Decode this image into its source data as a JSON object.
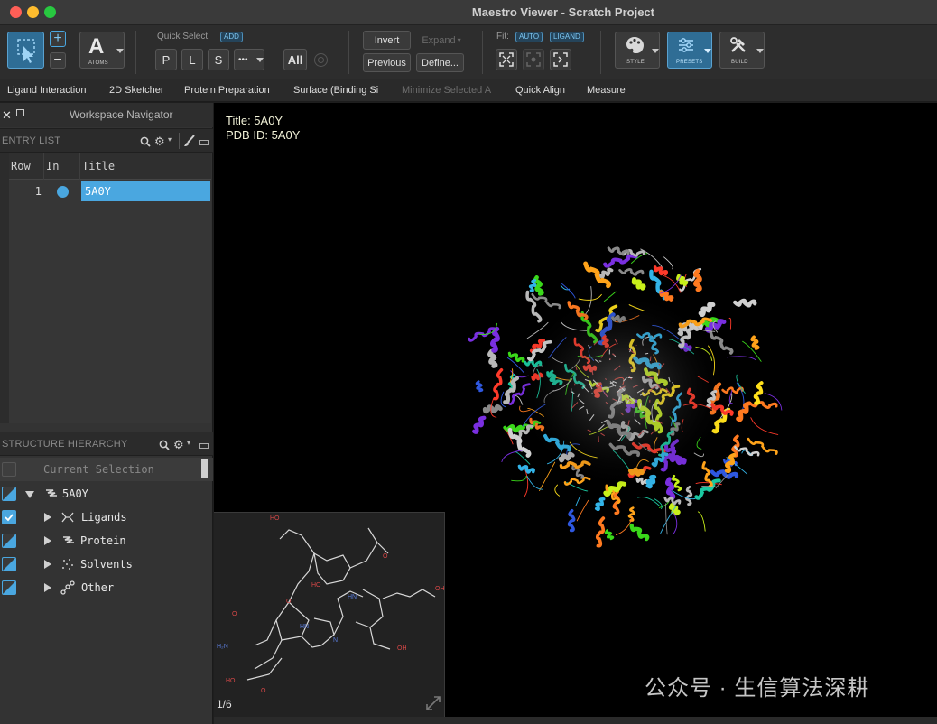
{
  "window": {
    "title": "Maestro Viewer - Scratch Project"
  },
  "toolbar": {
    "atoms_label": "ATOMS",
    "atoms_glyph": "A",
    "quick_select_label": "Quick Select:",
    "add_pill": "ADD",
    "p": "P",
    "l": "L",
    "s": "S",
    "more": "•••",
    "all": "All",
    "invert": "Invert",
    "expand": "Expand",
    "previous": "Previous",
    "define": "Define...",
    "fit_label": "Fit:",
    "auto_pill": "AUTO",
    "ligand_pill": "LIGAND",
    "style_label": "STYLE",
    "presets_label": "PRESETS",
    "build_label": "BUILD"
  },
  "menu": {
    "items": [
      {
        "label": "Ligand Interaction",
        "enabled": true
      },
      {
        "label": "2D Sketcher",
        "enabled": true
      },
      {
        "label": "Protein Preparation",
        "enabled": true
      },
      {
        "label": "Surface (Binding Si",
        "enabled": true
      },
      {
        "label": "Minimize Selected A",
        "enabled": false
      },
      {
        "label": "Quick Align",
        "enabled": true
      },
      {
        "label": "Measure",
        "enabled": true
      }
    ]
  },
  "navigator": {
    "title": "Workspace Navigator",
    "entry_list": {
      "title": "ENTRY LIST",
      "columns": [
        "Row",
        "In",
        "Title"
      ],
      "rows": [
        {
          "row": "1",
          "in": true,
          "title": "5A0Y"
        }
      ]
    },
    "structure_hierarchy": {
      "title": "STRUCTURE HIERARCHY",
      "current_selection": "Current Selection",
      "root": "5A0Y",
      "children": [
        "Ligands",
        "Protein",
        "Solvents",
        "Other"
      ]
    }
  },
  "viewport": {
    "title_line": "Title: 5A0Y",
    "pdb_line": "PDB ID: 5A0Y",
    "sketch_page": "1/6",
    "watermark": "公众号 · 生信算法深耕"
  },
  "colors": {
    "accent": "#4aa7e0",
    "viewport_bg": "#000000",
    "panel_bg": "#333333"
  }
}
